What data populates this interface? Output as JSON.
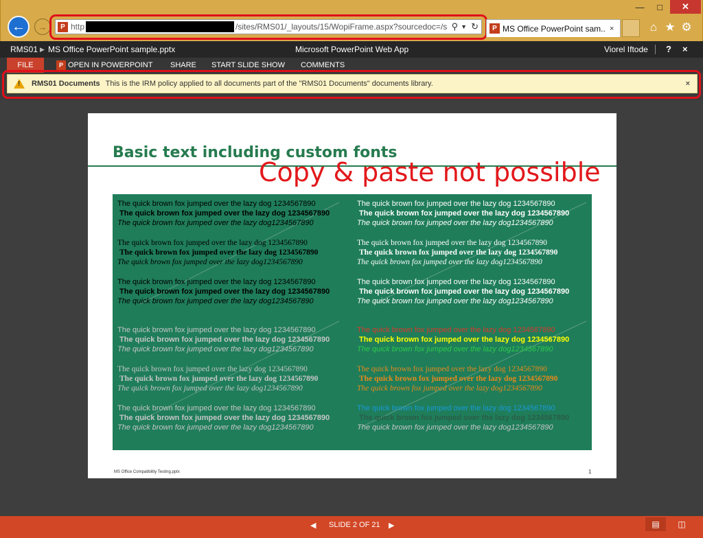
{
  "browser": {
    "address_prefix": "http",
    "address_rest": "/sites/RMS01/_layouts/15/WopiFrame.aspx?sourcedoc=/sites.",
    "tab_title": "MS Office PowerPoint sam...",
    "tab_close": "×",
    "icons": {
      "back": "back-arrow-icon",
      "forward": "forward-arrow-icon",
      "home": "home-icon",
      "favorites": "star-icon",
      "tools": "gear-icon"
    }
  },
  "appbar": {
    "breadcrumb_root": "RMS01",
    "breadcrumb_sep": "▶",
    "file_name": "MS Office PowerPoint sample.pptx",
    "app_title": "Microsoft PowerPoint Web App",
    "user_name": "Viorel Iftode",
    "help": "?",
    "close": "×"
  },
  "ribbon": {
    "file": "FILE",
    "open_in_powerpoint": "OPEN IN POWERPOINT",
    "share": "SHARE",
    "start_slide_show": "START SLIDE SHOW",
    "comments": "COMMENTS"
  },
  "infobar": {
    "title": "RMS01 Documents",
    "message": "This is the IRM policy applied to all documents part of the \"RMS01 Documents\" documents library.",
    "close": "×"
  },
  "slide": {
    "title": "Basic text including custom fonts",
    "annotation": "Copy & paste not possible",
    "footer": "MS Office Compatibility Testing.pptx",
    "number": "1",
    "line_regular": "The quick brown fox jumped over the lazy dog 1234567890",
    "line_italic": "The quick brown fox jumped over the lazy dog1234567890",
    "colors": {
      "background": "#1f7d5a",
      "black": "#000000",
      "white": "#ffffff",
      "gray": "#c6c6c6",
      "red": "#d93a2b",
      "yellow": "#ffff00",
      "green": "#2ccc4a",
      "orange": "#e88a1c",
      "blue": "#1a9ad6",
      "dark": "#2a5d4a"
    }
  },
  "status": {
    "prev": "◀",
    "counter": "SLIDE 2 OF 21",
    "next": "▶",
    "reading_view": "reading-view-icon",
    "slideshow_view": "slideshow-view-icon"
  }
}
